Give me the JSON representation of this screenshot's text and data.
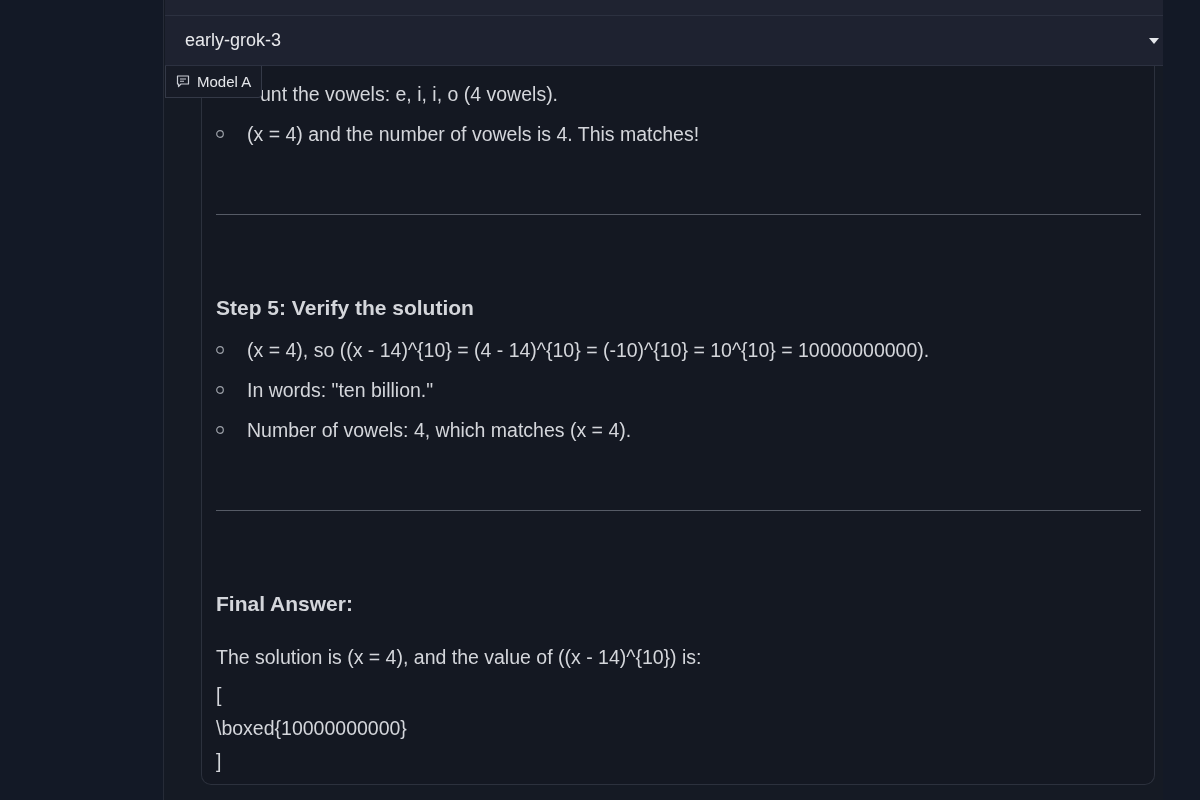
{
  "model_selector": {
    "value": "early-grok-3"
  },
  "message": {
    "label": "Model A",
    "blocks": [
      {
        "kind": "list",
        "items": [
          {
            "text": "unt the vowels: e, i, i, o (4 vowels).",
            "covered": true
          },
          {
            "text": "(x = 4) and the number of vowels is 4. This matches!",
            "covered": false
          }
        ]
      },
      {
        "kind": "rule"
      },
      {
        "kind": "heading",
        "text": "Step 5: Verify the solution"
      },
      {
        "kind": "list",
        "items": [
          {
            "text": "(x = 4), so ((x - 14)^{10} = (4 - 14)^{10} = (-10)^{10} = 10^{10} = 10000000000).",
            "covered": false
          },
          {
            "text": "In words: \"ten billion.\"",
            "covered": false
          },
          {
            "text": "Number of vowels: 4, which matches (x = 4).",
            "covered": false
          }
        ]
      },
      {
        "kind": "rule"
      },
      {
        "kind": "heading",
        "text": "Final Answer:"
      },
      {
        "kind": "paragraph",
        "text": "The solution is (x = 4), and the value of ((x - 14)^{10}) is:"
      },
      {
        "kind": "line",
        "text": "["
      },
      {
        "kind": "line",
        "text": "\\boxed{10000000000}"
      },
      {
        "kind": "line",
        "text": "]"
      }
    ]
  }
}
